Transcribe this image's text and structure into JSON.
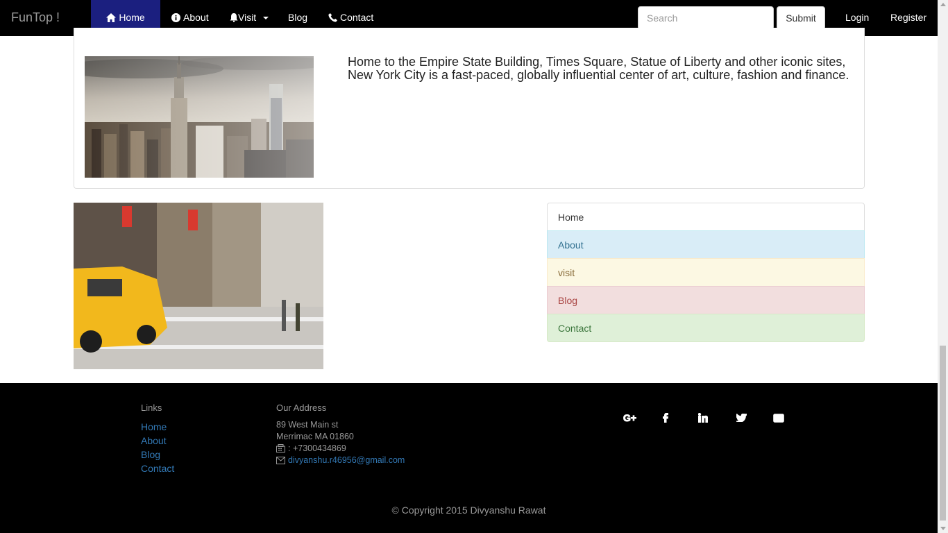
{
  "navbar": {
    "brand": "FunTop !",
    "items": [
      {
        "label": "Home",
        "icon": "home-icon"
      },
      {
        "label": "About",
        "icon": "info-icon"
      },
      {
        "label": "Visit",
        "icon": "bell-icon"
      },
      {
        "label": "Blog"
      },
      {
        "label": "Contact",
        "icon": "phone-icon"
      }
    ],
    "search_placeholder": "Search",
    "submit_label": "Submit",
    "login_label": "Login",
    "register_label": "Register",
    "active_color": "#1b1f7f"
  },
  "panel": {
    "text": "Home to the Empire State Building, Times Square, Statue of Liberty and other iconic sites, New York City is a fast-paced, globally influential center of art, culture, fashion and finance."
  },
  "list_group": [
    {
      "label": "Home",
      "style": "default"
    },
    {
      "label": "About",
      "style": "info"
    },
    {
      "label": "visit",
      "style": "warning"
    },
    {
      "label": "Blog",
      "style": "danger"
    },
    {
      "label": "Contact",
      "style": "success"
    }
  ],
  "footer": {
    "links_heading": "Links",
    "links": [
      "Home",
      "About",
      "Blog",
      "Contact"
    ],
    "address_heading": "Our Address",
    "address_line1": "89 West Main st",
    "address_line2": "Merrimac MA 01860",
    "phone": ": +7300434869",
    "email": "divyanshu.r46956@gmail.com",
    "social_icons": [
      "google-plus-icon",
      "facebook-icon",
      "linkedin-icon",
      "twitter-icon",
      "envelope-icon"
    ],
    "copyright": "© Copyright 2015 Divyanshu Rawat"
  }
}
